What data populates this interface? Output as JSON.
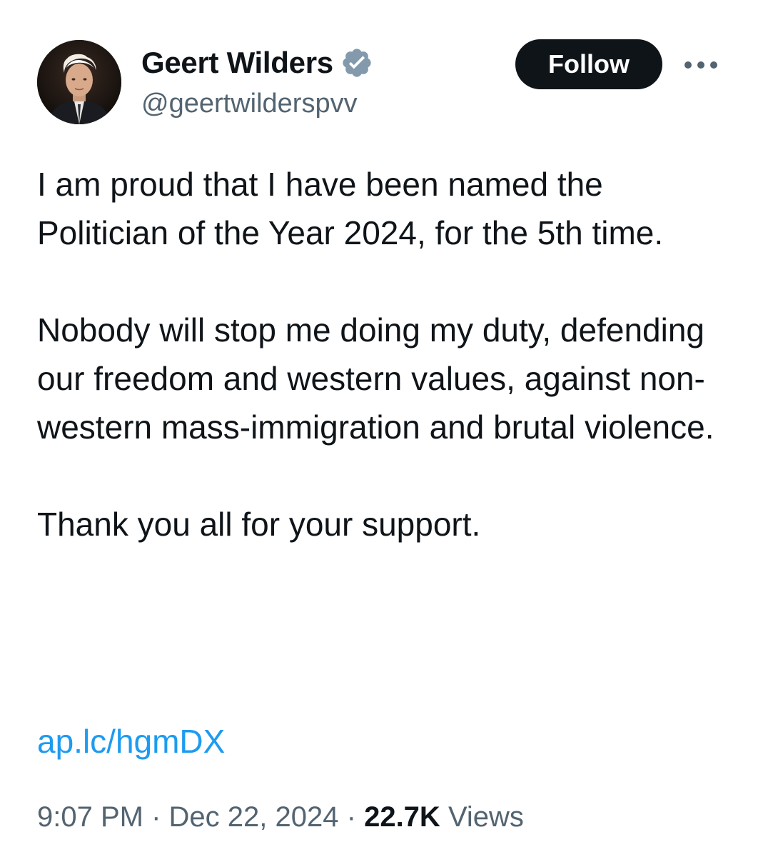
{
  "author": {
    "display_name": "Geert Wilders",
    "handle": "@geertwilderspvv",
    "verified": true,
    "verified_color": "#829aab",
    "avatar_icon": "profile-photo"
  },
  "actions": {
    "follow_label": "Follow",
    "more_icon": "ellipsis-icon"
  },
  "tweet": {
    "paragraphs": [
      "I am proud that I have been named the Politician of the Year 2024, for the 5th time.",
      "Nobody will stop me doing my duty, defending our freedom and western values, against non-western mass-immigration and brutal violence.",
      "Thank you all for your support."
    ],
    "link": "ap.lc/hgmDX"
  },
  "meta": {
    "time": "9:07 PM",
    "separator": "·",
    "date": "Dec 22, 2024",
    "views_count": "22.7K",
    "views_label": "Views"
  },
  "colors": {
    "text": "#0f1419",
    "secondary": "#536471",
    "link": "#1d9bf0",
    "button_bg": "#0f1419",
    "button_text": "#ffffff"
  }
}
